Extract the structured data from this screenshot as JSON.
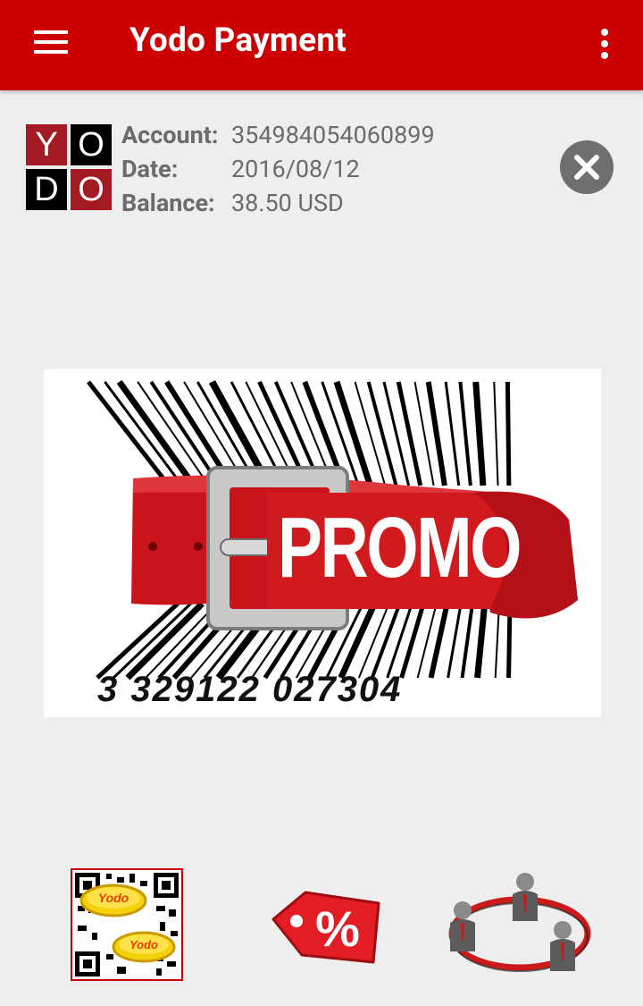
{
  "app_bar": {
    "title": "Yodo Payment",
    "menu_icon": "hamburger-menu-icon",
    "overflow_icon": "more-vertical-icon",
    "background_color": "#cc0000"
  },
  "logo": {
    "letters": [
      "Y",
      "O",
      "D",
      "O"
    ],
    "colors": [
      "#a31a22",
      "#000000",
      "#000000",
      "#a31a22"
    ]
  },
  "account": {
    "account_label": "Account:",
    "account_value": "354984054060899",
    "date_label": "Date:",
    "date_value": "2016/08/12",
    "balance_label": "Balance:",
    "balance_value": "38.50 USD",
    "close_icon": "close-circle-icon"
  },
  "promo": {
    "text": "PROMO",
    "barcode_number": "3 329122 027304"
  },
  "actions": [
    {
      "name": "qr-code-coins-icon",
      "coin_text": "Yodo"
    },
    {
      "name": "discount-tag-icon",
      "symbol": "%"
    },
    {
      "name": "people-network-icon"
    }
  ]
}
